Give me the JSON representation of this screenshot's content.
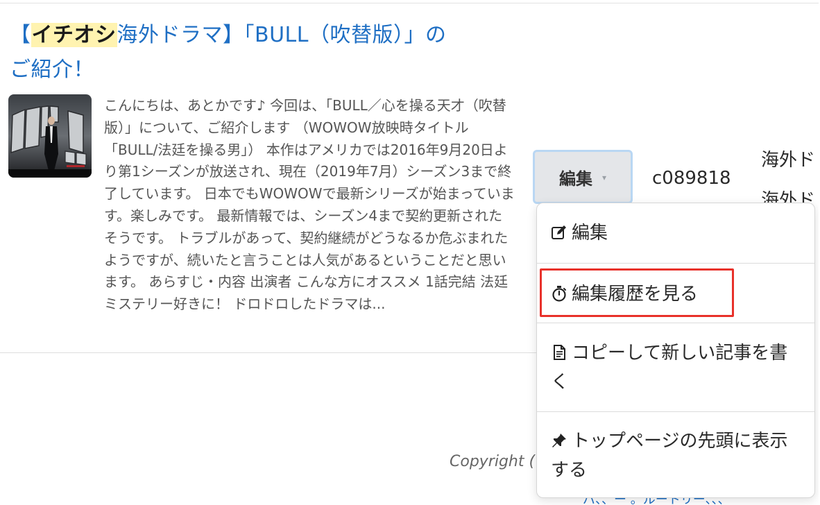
{
  "article": {
    "title_bracket_open": "【",
    "title_highlight": "イチオシ",
    "title_rest_line1": "海外ドラマ】「BULL（吹替版）」の",
    "title_line2": "ご紹介！",
    "thumbnail_icon": "bull-poster-thumbnail",
    "excerpt": "こんにちは、あとかです♪ 今回は、「BULL／心を操る天才（吹替版）」について、ご紹介します （WOWOW放映時タイトル「BULL/法廷を操る男」） 本作はアメリカでは2016年9月20日より第1シーズンが放送され、現在（2019年7月）シーズン3まで終了しています。 日本でもWOWOWで最新シリーズが始まっています。楽しみです。 最新情報では、シーズン4まで契約更新されたそうです。 トラブルがあって、契約継続がどうなるか危ぶまれたようですが、続いたと言うことは人気があるということだと思います。 あらすじ・内容 出演者 こんな方にオススメ 1話完結 法廷ミステリー好きに！ ドロドロしたドラマは..."
  },
  "edit_dropdown": {
    "button_label": "編集",
    "caret": "▾",
    "items": [
      {
        "label": "編集",
        "icon": "pencil-square-icon"
      },
      {
        "label": "編集履歴を見る",
        "icon": "stopwatch-icon"
      },
      {
        "label": "コピーして新しい記事を書く",
        "icon": "document-icon"
      },
      {
        "label": "トップページの先頭に表示する",
        "icon": "pin-icon"
      }
    ]
  },
  "meta": {
    "user_id": "c089818",
    "category_1": "海外ド",
    "category_2": "海外ド"
  },
  "footer": {
    "copyright": "Copyright (",
    "link_partial": "パ、、ー 。ルートリー、、、"
  },
  "colors": {
    "title_link": "#1f6fc4",
    "title_highlight_bg": "#fff3b0",
    "annotation_box": "#e8312a",
    "button_focus_ring": "#b9d7f3"
  }
}
